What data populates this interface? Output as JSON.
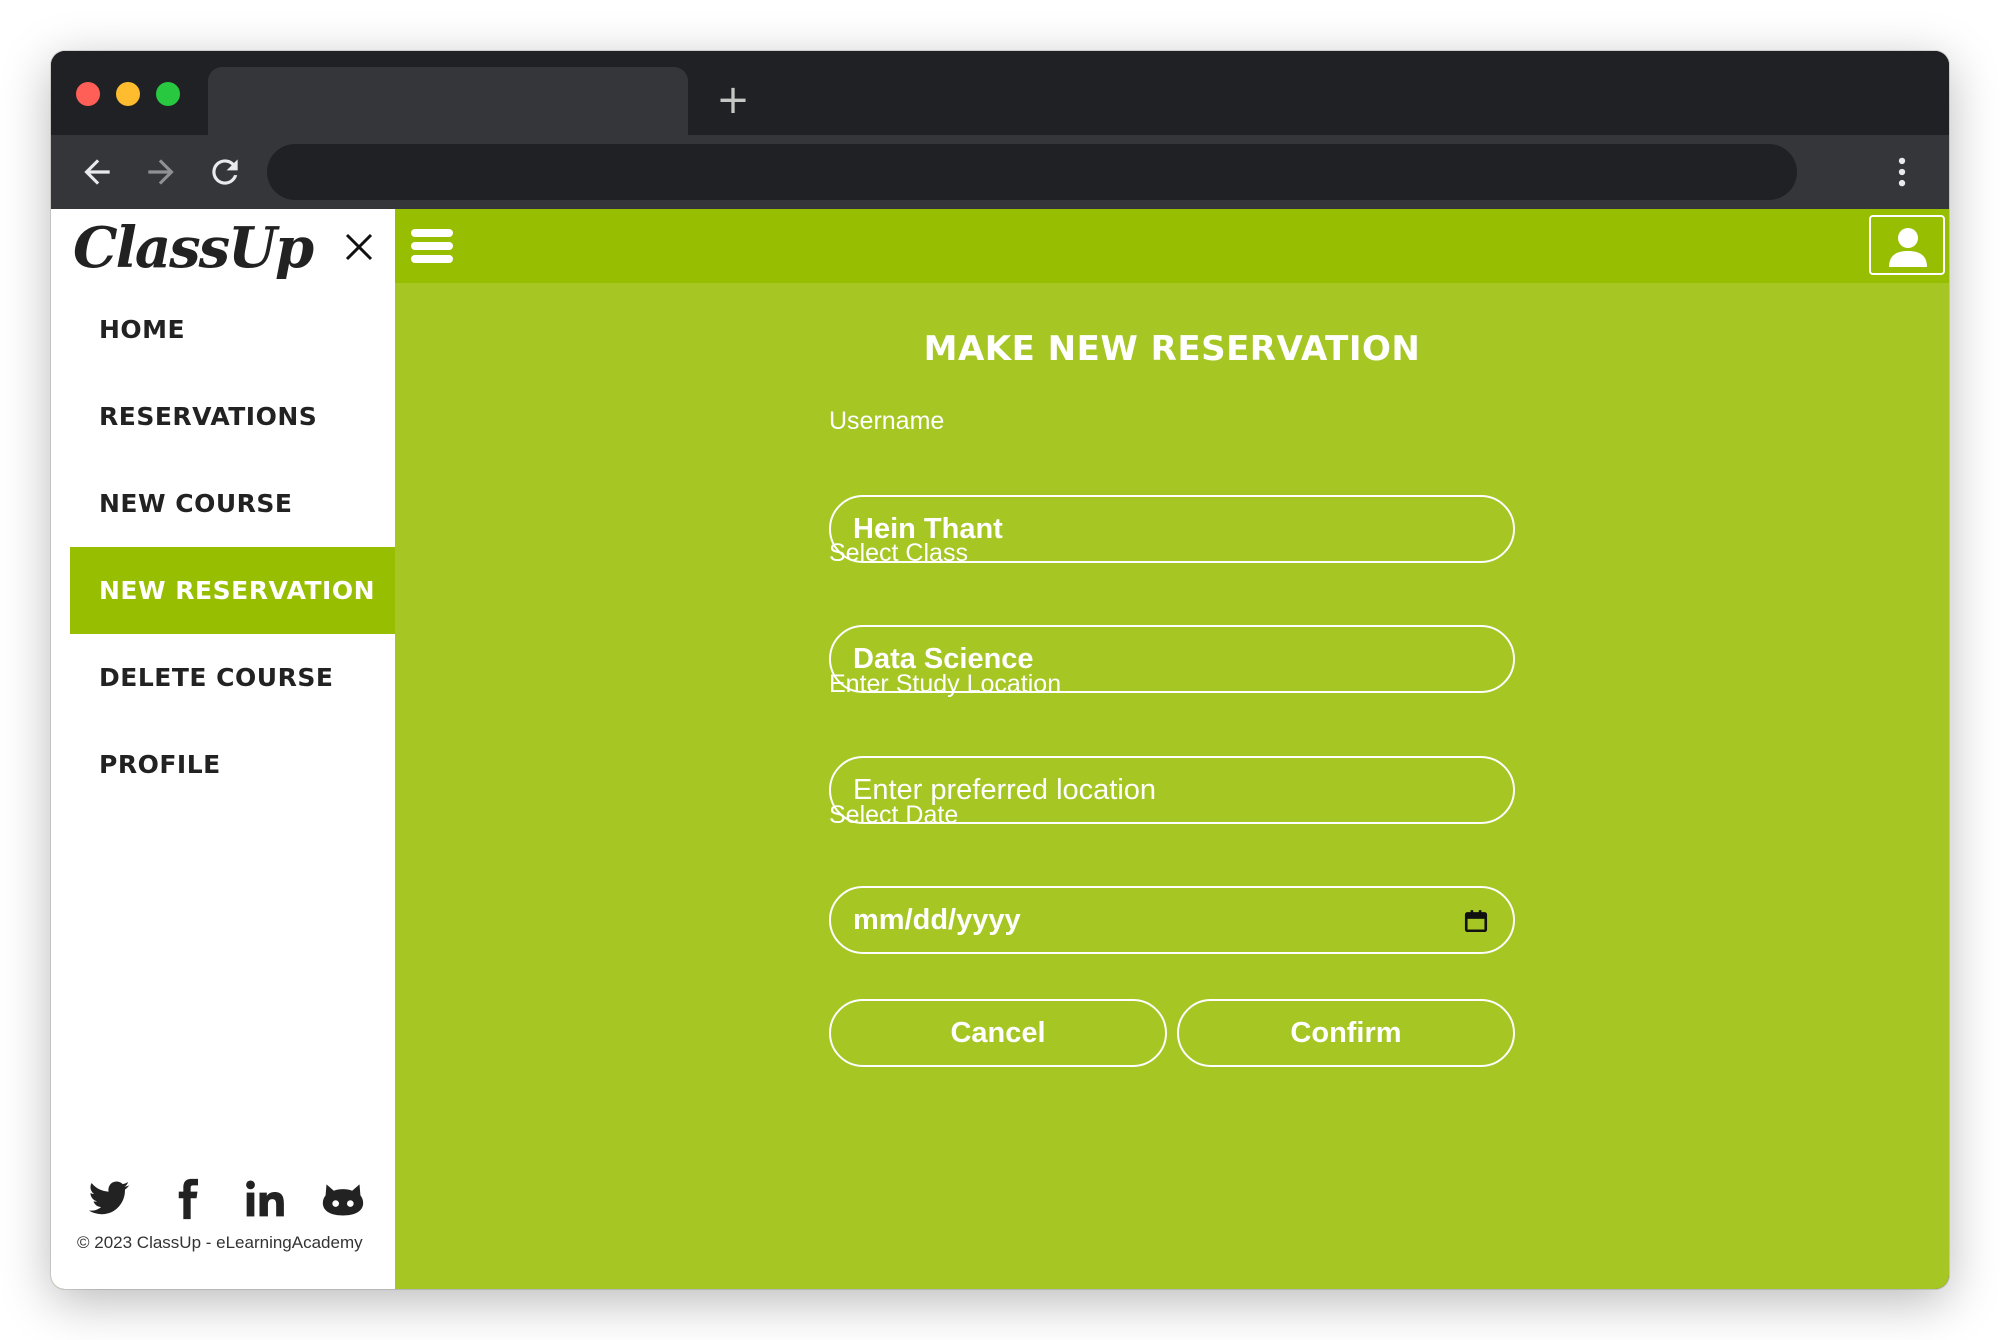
{
  "browser": {
    "new_tab_symbol": "+",
    "menu_icon": "more-vert-icon"
  },
  "sidebar": {
    "logo": "ClassUp",
    "items": [
      {
        "label": "HOME",
        "active": false
      },
      {
        "label": "RESERVATIONS",
        "active": false
      },
      {
        "label": "NEW COURSE",
        "active": false
      },
      {
        "label": "NEW RESERVATION",
        "active": true
      },
      {
        "label": "DELETE COURSE",
        "active": false
      },
      {
        "label": "PROFILE",
        "active": false
      }
    ],
    "socials": [
      "twitter-icon",
      "facebook-icon",
      "linkedin-icon",
      "github-icon"
    ],
    "copyright": "© 2023 ClassUp - eLearningAcademy"
  },
  "form": {
    "title": "MAKE NEW RESERVATION",
    "username_label": "Username",
    "username_value": "Hein Thant",
    "class_label": "Select Class",
    "class_value": "Data Science",
    "location_label": "Enter Study Location",
    "location_placeholder": "Enter preferred location",
    "date_label": "Select Date",
    "date_placeholder": "mm/dd/yyyy",
    "cancel_label": "Cancel",
    "confirm_label": "Confirm"
  },
  "colors": {
    "page_green": "#a5c623",
    "accent_green": "#97be00",
    "sidebar_bg": "#ffffff",
    "text_dark": "#222222"
  }
}
